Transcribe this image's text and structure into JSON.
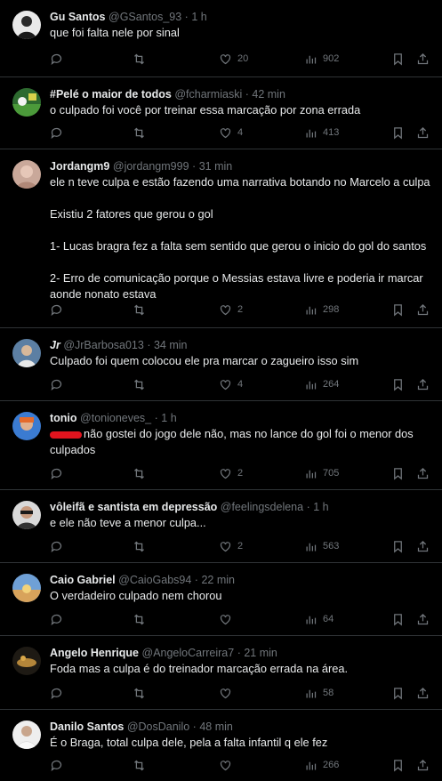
{
  "tweets": [
    {
      "name": "Gu Santos",
      "handle": "@GSantos_93",
      "dot": "·",
      "time": "1 h",
      "text": "que foi falta nele por sinal",
      "replies": "",
      "retweets": "",
      "likes": "20",
      "views": "902"
    },
    {
      "name": "#Pelé o maior de todos",
      "handle": "@fcharmiaski",
      "dot": "·",
      "time": "42 min",
      "text": "o culpado foi você por treinar essa marcação por zona errada",
      "replies": "",
      "retweets": "",
      "likes": "4",
      "views": "413"
    },
    {
      "name": "Jordangm9",
      "handle": "@jordangm999",
      "dot": "·",
      "time": "31 min",
      "text": "ele n teve culpa e estão fazendo uma narrativa botando no Marcelo a culpa\n\nExistiu 2 fatores que gerou o gol\n\n1- Lucas bragra fez a falta sem sentido que gerou o inicio do gol do santos\n\n2- Erro de comunicação porque o Messias estava livre e poderia ir marcar aonde nonato estava",
      "replies": "",
      "retweets": "",
      "likes": "2",
      "views": "298"
    },
    {
      "name": "Jr",
      "handle": "@JrBarbosa013",
      "dot": "·",
      "time": "34 min",
      "text": "Culpado foi quem colocou ele pra marcar o zagueiro isso sim",
      "replies": "",
      "retweets": "",
      "likes": "4",
      "views": "264"
    },
    {
      "name": "tonio",
      "handle": "@tonioneves_",
      "dot": "·",
      "time": "1 h",
      "text": "não gostei do jogo dele não, mas no lance do gol foi o menor dos culpados",
      "replies": "",
      "retweets": "",
      "likes": "2",
      "views": "705"
    },
    {
      "name": "vôleifã e santista em depressão",
      "handle": "@feelingsdelena",
      "dot": "·",
      "time": "1 h",
      "text": "e ele não teve a menor culpa...",
      "replies": "",
      "retweets": "",
      "likes": "2",
      "views": "563"
    },
    {
      "name": "Caio Gabriel",
      "handle": "@CaioGabs94",
      "dot": "·",
      "time": "22 min",
      "text": "O verdadeiro culpado nem chorou",
      "replies": "",
      "retweets": "",
      "likes": "",
      "views": "64"
    },
    {
      "name": "Angelo Henrique",
      "handle": "@AngeloCarreira7",
      "dot": "·",
      "time": "21 min",
      "text": "Foda mas a culpa é do treinador marcação errada na área.",
      "replies": "",
      "retweets": "",
      "likes": "",
      "views": "58"
    },
    {
      "name": "Danilo Santos",
      "handle": "@DosDanilo",
      "dot": "·",
      "time": "48 min",
      "text": "É o Braga, total culpa dele, pela a falta infantil q ele fez",
      "replies": "",
      "retweets": "",
      "likes": "",
      "views": "266"
    }
  ],
  "colors": {
    "background": "#000000",
    "text": "#e7e9ea",
    "muted": "#71767b",
    "divider": "#2f3336",
    "redaction": "#e0141e"
  },
  "icons": {
    "reply": "reply-icon",
    "retweet": "retweet-icon",
    "like": "like-icon",
    "views": "views-icon",
    "bookmark": "bookmark-icon",
    "share": "share-icon",
    "more": "more-icon"
  }
}
